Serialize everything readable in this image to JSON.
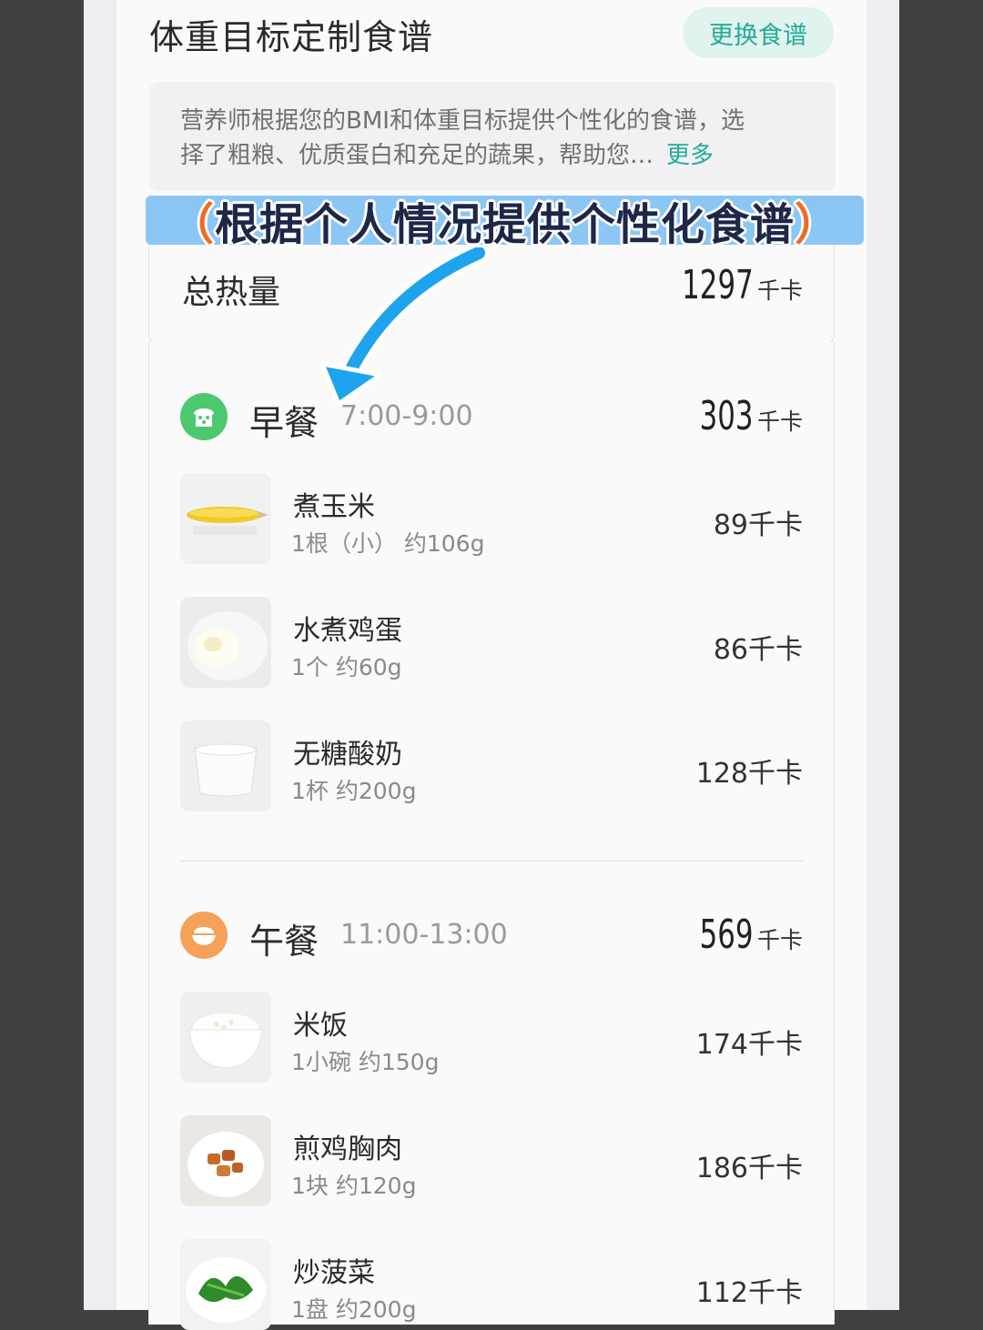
{
  "header": {
    "title": "体重目标定制食谱",
    "switch_label": "更换食谱"
  },
  "description": {
    "text_line1": "营养师根据您的BMI和体重目标提供个性化的食谱，选",
    "text_line2": "择了粗粮、优质蛋白和充足的蔬果，帮助您…",
    "more_label": "更多"
  },
  "banner": {
    "left_paren": "（",
    "text": "根据个人情况提供个性化食谱",
    "right_paren": "）"
  },
  "total": {
    "label": "总热量",
    "value": "1297",
    "unit": "千卡"
  },
  "meals": [
    {
      "name": "早餐",
      "time": "7:00-9:00",
      "kcal": "303",
      "unit": "千卡",
      "icon": "bread-icon",
      "icon_color": "#4cc86e",
      "foods": [
        {
          "name": "煮玉米",
          "portion": "1根（小） 约106g",
          "kcal": "89千卡",
          "icon": "corn-icon"
        },
        {
          "name": "水煮鸡蛋",
          "portion": "1个 约60g",
          "kcal": "86千卡",
          "icon": "egg-icon"
        },
        {
          "name": "无糖酸奶",
          "portion": "1杯 约200g",
          "kcal": "128千卡",
          "icon": "yogurt-icon"
        }
      ]
    },
    {
      "name": "午餐",
      "time": "11:00-13:00",
      "kcal": "569",
      "unit": "千卡",
      "icon": "rice-bowl-icon",
      "icon_color": "#f5a15a",
      "foods": [
        {
          "name": "米饭",
          "portion": "1小碗 约150g",
          "kcal": "174千卡",
          "icon": "rice-icon"
        },
        {
          "name": "煎鸡胸肉",
          "portion": "1块 约120g",
          "kcal": "186千卡",
          "icon": "chicken-icon"
        },
        {
          "name": "炒菠菜",
          "portion": "1盘 约200g",
          "kcal": "112千卡",
          "icon": "spinach-icon"
        }
      ]
    }
  ],
  "colors": {
    "accent": "#22ad96",
    "banner_bg": "#8cc6f5",
    "arrow": "#1ea4ee"
  }
}
